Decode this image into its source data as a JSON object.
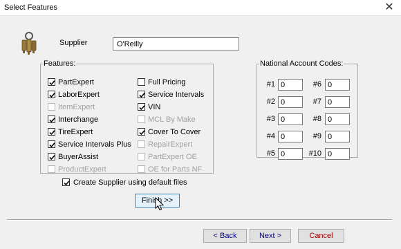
{
  "window": {
    "title": "Select Features",
    "close_glyph": "✕"
  },
  "supplier": {
    "label": "Supplier",
    "value": "O'Reilly"
  },
  "features": {
    "legend": "Features:",
    "items": [
      {
        "label": "PartExpert",
        "checked": true,
        "enabled": true
      },
      {
        "label": "LaborExpert",
        "checked": true,
        "enabled": true
      },
      {
        "label": "ItemExpert",
        "checked": false,
        "enabled": false
      },
      {
        "label": "Interchange",
        "checked": true,
        "enabled": true
      },
      {
        "label": "TireExpert",
        "checked": true,
        "enabled": true
      },
      {
        "label": "Service Intervals Plus",
        "checked": true,
        "enabled": true
      },
      {
        "label": "BuyerAssist",
        "checked": true,
        "enabled": true
      },
      {
        "label": "ProductExpert",
        "checked": false,
        "enabled": false
      },
      {
        "label": "Full Pricing",
        "checked": false,
        "enabled": true
      },
      {
        "label": "Service Intervals",
        "checked": true,
        "enabled": true
      },
      {
        "label": "VIN",
        "checked": true,
        "enabled": true
      },
      {
        "label": "MCL By Make",
        "checked": false,
        "enabled": false
      },
      {
        "label": "Cover To Cover",
        "checked": true,
        "enabled": true
      },
      {
        "label": "RepairExpert",
        "checked": false,
        "enabled": false
      },
      {
        "label": "PartExpert OE",
        "checked": false,
        "enabled": false
      },
      {
        "label": "OE for Parts NF",
        "checked": false,
        "enabled": false
      }
    ]
  },
  "national_account_codes": {
    "legend": "National Account Codes:",
    "codes": [
      {
        "label": "#1",
        "value": "0"
      },
      {
        "label": "#2",
        "value": "0"
      },
      {
        "label": "#3",
        "value": "0"
      },
      {
        "label": "#4",
        "value": "0"
      },
      {
        "label": "#5",
        "value": "0"
      },
      {
        "label": "#6",
        "value": "0"
      },
      {
        "label": "#7",
        "value": "0"
      },
      {
        "label": "#8",
        "value": "0"
      },
      {
        "label": "#9",
        "value": "0"
      },
      {
        "label": "#10",
        "value": "0"
      }
    ]
  },
  "default_files": {
    "label": "Create Supplier using default files",
    "checked": true
  },
  "buttons": {
    "finish": "Finish >>",
    "back": "< Back",
    "next": "Next >",
    "cancel": "Cancel"
  },
  "colors": {
    "cancel_text": "#a00000",
    "next_text": "#000080"
  },
  "icons": {
    "app": "keys-icon",
    "cursor": "mouse-pointer-icon",
    "close": "close-icon"
  }
}
